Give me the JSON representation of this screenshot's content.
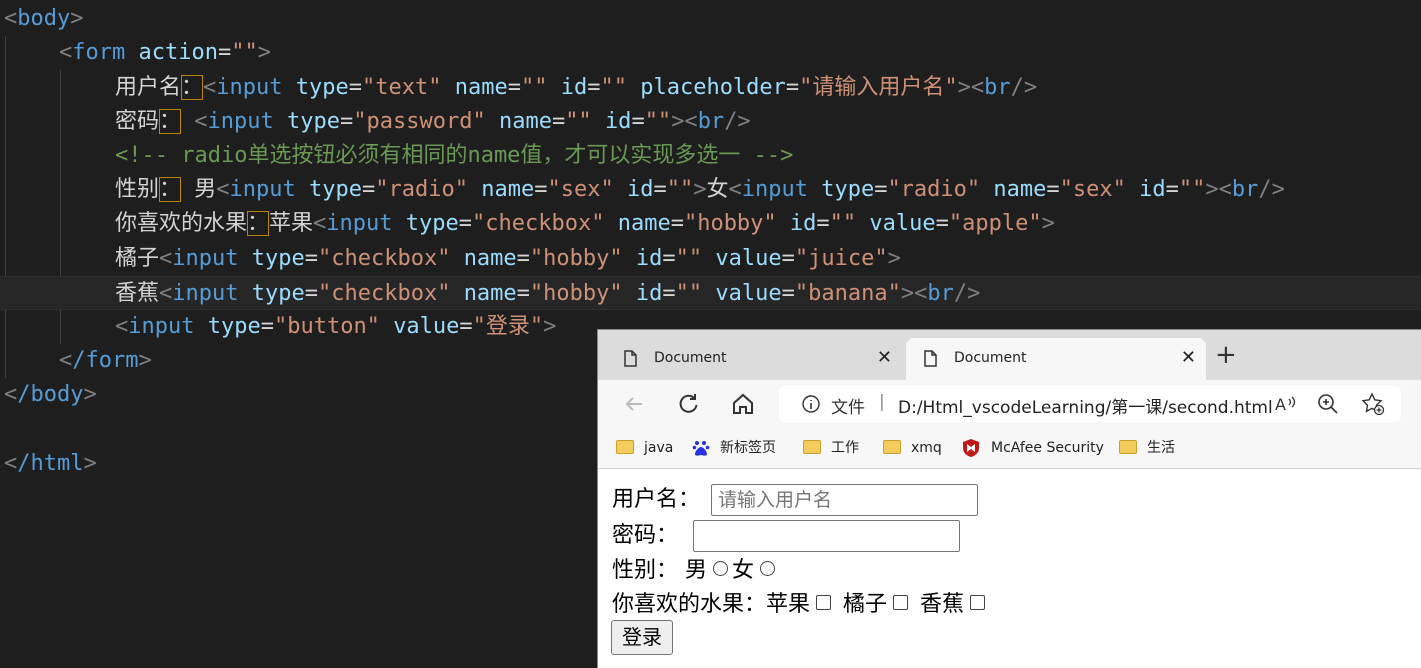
{
  "editor": {
    "l0": {
      "tag": "body"
    },
    "l1": {
      "tag": "form",
      "attr": "action",
      "val": "\"\""
    },
    "l2": {
      "label": "用户名",
      "colon": "：",
      "tag": "input",
      "a1": "type",
      "v1": "\"text\"",
      "a2": "name",
      "v2": "\"\"",
      "a3": "id",
      "v3": "\"\"",
      "a4": "placeholder",
      "v4": "\"请输入用户名\"",
      "br": "br"
    },
    "l3": {
      "label": "密码",
      "colon": "：",
      "tag": "input",
      "a1": "type",
      "v1": "\"password\"",
      "a2": "name",
      "v2": "\"\"",
      "a3": "id",
      "v3": "\"\"",
      "br": "br"
    },
    "l4": {
      "comment": "<!-- radio单选按钮必须有相同的name值，才可以实现多选一 -->"
    },
    "l5": {
      "label": "性别",
      "colon": "：",
      "t1": "男",
      "tag": "input",
      "a1": "type",
      "v1": "\"radio\"",
      "a2": "name",
      "v2": "\"sex\"",
      "a3": "id",
      "v3": "\"\"",
      "t2": "女",
      "b1": "type",
      "w1": "\"radio\"",
      "b2": "name",
      "w2": "\"sex\"",
      "b3": "id",
      "w3": "\"\"",
      "br": "br"
    },
    "l6": {
      "label": "你喜欢的水果",
      "colon": "：",
      "t1": "苹果",
      "tag": "input",
      "a1": "type",
      "v1": "\"checkbox\"",
      "a2": "name",
      "v2": "\"hobby\"",
      "a3": "id",
      "v3": "\"\"",
      "a4": "value",
      "v4": "\"apple\""
    },
    "l7": {
      "t1": "橘子",
      "tag": "input",
      "a1": "type",
      "v1": "\"checkbox\"",
      "a2": "name",
      "v2": "\"hobby\"",
      "a3": "id",
      "v3": "\"\"",
      "a4": "value",
      "v4": "\"juice\""
    },
    "l8": {
      "t1": "香蕉",
      "tag": "input",
      "a1": "type",
      "v1": "\"checkbox\"",
      "a2": "name",
      "v2": "\"hobby\"",
      "a3": "id",
      "v3": "\"\"",
      "a4": "value",
      "v4": "\"banana\"",
      "br": "br"
    },
    "l9": {
      "tag": "input",
      "a1": "type",
      "v1": "\"button\"",
      "a2": "value",
      "v2": "\"登录\""
    },
    "l10": {
      "tag": "/form"
    },
    "l11": {
      "tag": "/body"
    },
    "l13": {
      "tag": "/html"
    }
  },
  "browser": {
    "tabs": [
      {
        "label": "Document",
        "active": false
      },
      {
        "label": "Document",
        "active": true
      }
    ],
    "new_tab_icon": "plus-icon",
    "address": {
      "file_label": "文件",
      "separator": "|",
      "url": "D:/Html_vscodeLearning/第一课/second.html"
    },
    "bookmarks": [
      {
        "label": "java",
        "icon": "folder-icon"
      },
      {
        "label": "新标签页",
        "icon": "baidu-icon"
      },
      {
        "label": "工作",
        "icon": "folder-icon"
      },
      {
        "label": "xmq",
        "icon": "folder-icon"
      },
      {
        "label": "McAfee Security",
        "icon": "mcafee-icon"
      },
      {
        "label": "生活",
        "icon": "folder-icon"
      }
    ]
  },
  "page": {
    "username_label": "用户名：",
    "username_placeholder": "请输入用户名",
    "password_label": "密码：",
    "gender_label": "性别：",
    "gender_male": "男",
    "gender_female": "女",
    "fruit_label": "你喜欢的水果：",
    "fruit_apple": "苹果",
    "fruit_orange": "橘子",
    "fruit_banana": "香蕉",
    "login_button": "登录"
  },
  "colors": {
    "editor_bg": "#1e1e1e",
    "tag": "#569cd6",
    "attr": "#9cdcfe",
    "string": "#ce9178",
    "comment": "#6a9955"
  }
}
